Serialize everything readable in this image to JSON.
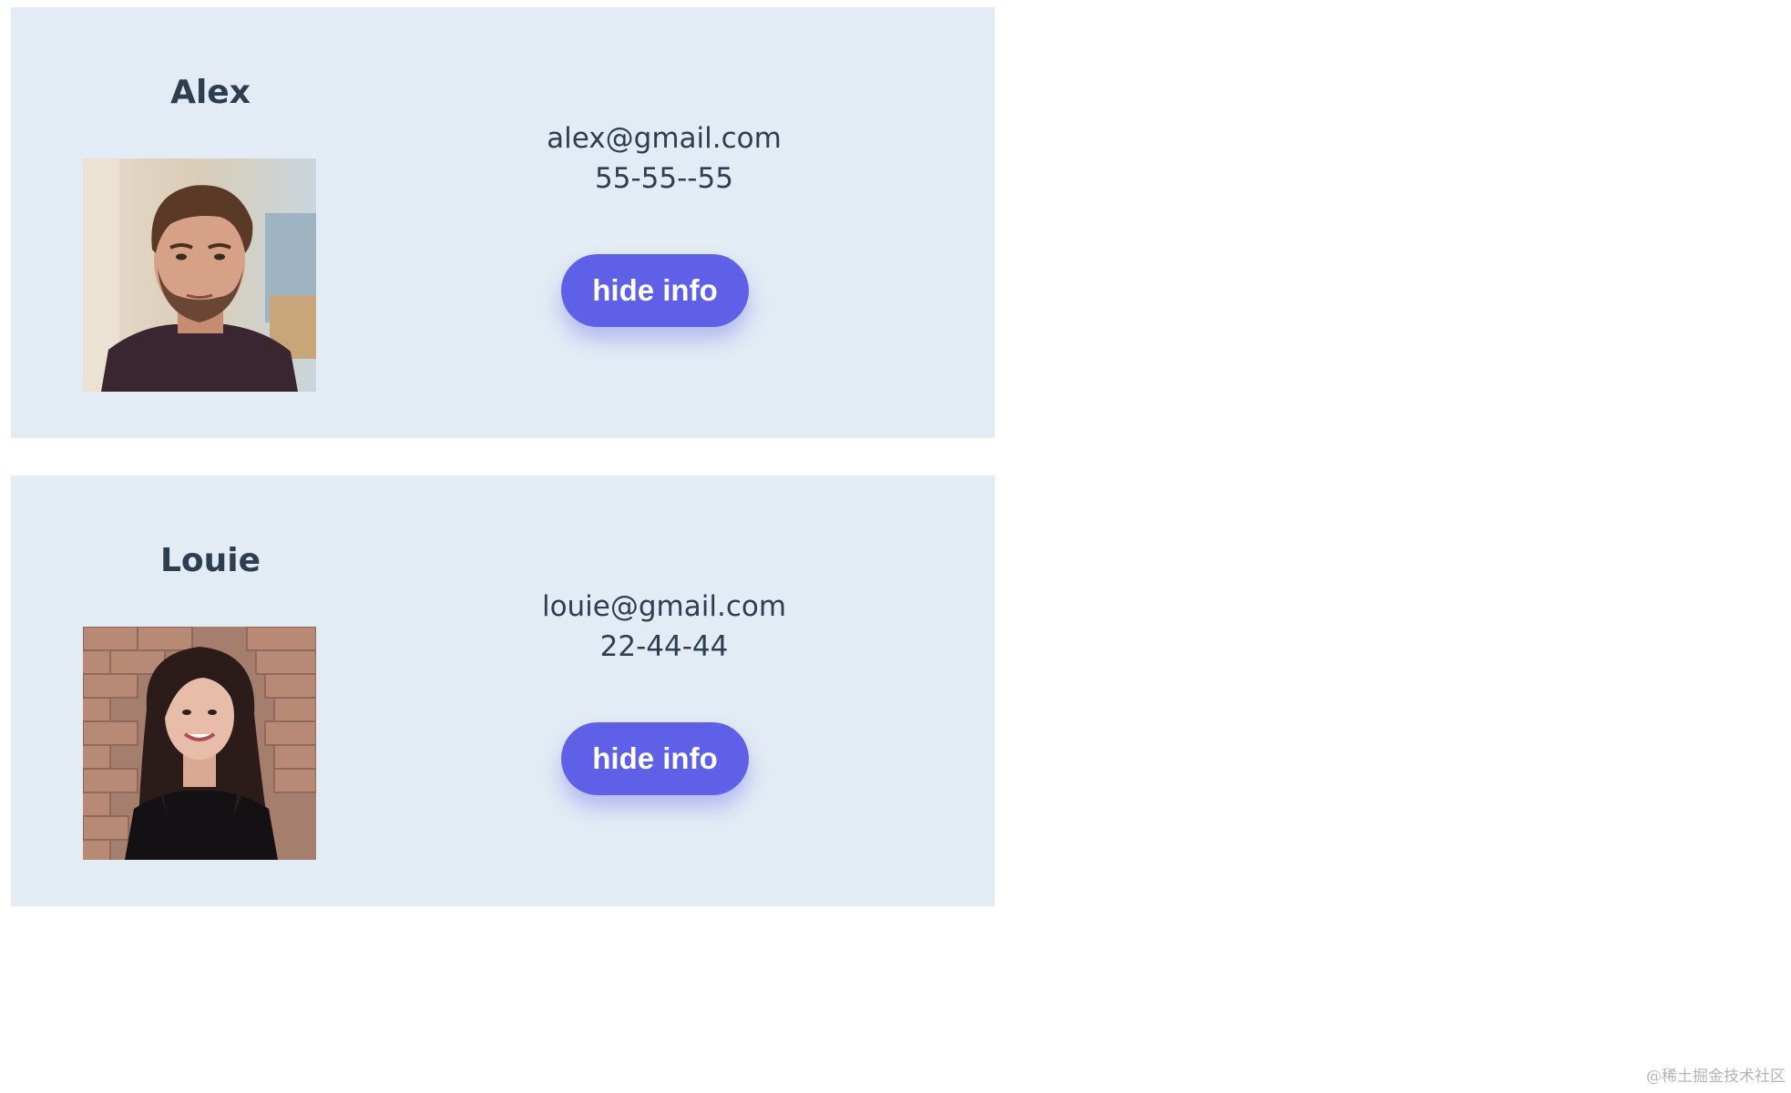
{
  "contacts": [
    {
      "name": "Alex",
      "email": "alex@gmail.com",
      "phone": "55-55--55",
      "button_label": "hide info",
      "photo_alt": "Alex"
    },
    {
      "name": "Louie",
      "email": "louie@gmail.com",
      "phone": "22-44-44",
      "button_label": "hide info",
      "photo_alt": "Louie"
    }
  ],
  "colors": {
    "card_background": "#e3ebf5",
    "button_background": "#5f60e8",
    "text": "#2c3e50"
  },
  "watermark": "@稀土掘金技术社区"
}
